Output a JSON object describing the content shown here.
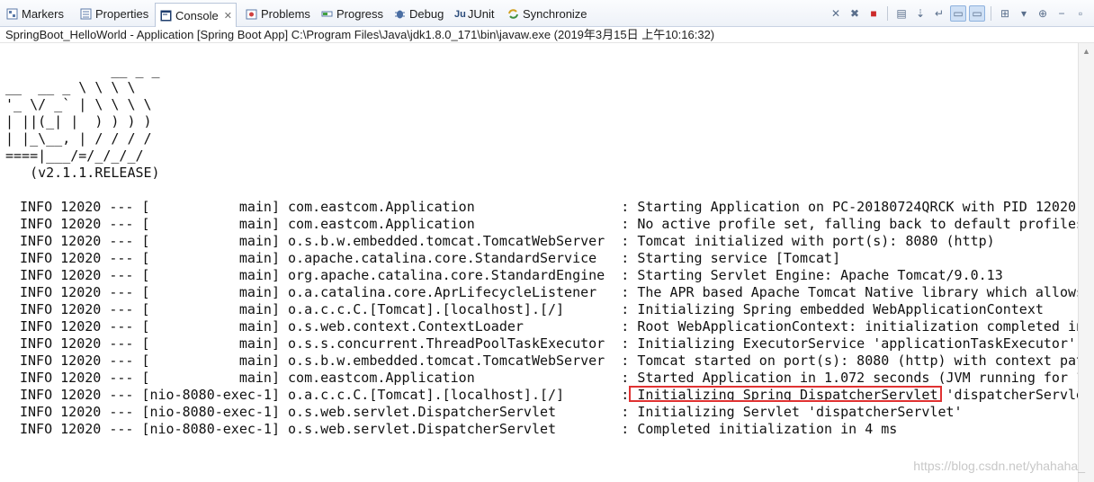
{
  "tabs": [
    {
      "label": "Markers",
      "icon": "markers-icon"
    },
    {
      "label": "Properties",
      "icon": "properties-icon"
    },
    {
      "label": "Console",
      "icon": "console-icon",
      "active": true
    },
    {
      "label": "Problems",
      "icon": "problems-icon"
    },
    {
      "label": "Progress",
      "icon": "progress-icon"
    },
    {
      "label": "Debug",
      "icon": "debug-icon"
    },
    {
      "label": "JUnit",
      "icon": "junit-icon"
    },
    {
      "label": "Synchronize",
      "icon": "synchronize-icon"
    }
  ],
  "console": {
    "description": "SpringBoot_HelloWorld - Application [Spring Boot App] C:\\Program Files\\Java\\jdk1.8.0_171\\bin\\javaw.exe (2019年3月15日 上午10:16:32)",
    "banner": "             __ _ _\n__  __ _ \\ \\ \\ \\\n'_ \\/ _` | \\ \\ \\ \\\n| ||(_| |  ) ) ) )\n| |_\\__, | / / / /\n====|___/=/_/_/_/\n   (v2.1.1.RELEASE)",
    "log_lines": [
      "INFO 12020 --- [           main] com.eastcom.Application                  : Starting Application on PC-20180724QRCK with PID 12020",
      "INFO 12020 --- [           main] com.eastcom.Application                  : No active profile set, falling back to default profiles",
      "INFO 12020 --- [           main] o.s.b.w.embedded.tomcat.TomcatWebServer  : Tomcat initialized with port(s): 8080 (http)",
      "INFO 12020 --- [           main] o.apache.catalina.core.StandardService   : Starting service [Tomcat]",
      "INFO 12020 --- [           main] org.apache.catalina.core.StandardEngine  : Starting Servlet Engine: Apache Tomcat/9.0.13",
      "INFO 12020 --- [           main] o.a.catalina.core.AprLifecycleListener   : The APR based Apache Tomcat Native library which allows",
      "INFO 12020 --- [           main] o.a.c.c.C.[Tomcat].[localhost].[/]       : Initializing Spring embedded WebApplicationContext",
      "INFO 12020 --- [           main] o.s.web.context.ContextLoader            : Root WebApplicationContext: initialization completed in",
      "INFO 12020 --- [           main] o.s.s.concurrent.ThreadPoolTaskExecutor  : Initializing ExecutorService 'applicationTaskExecutor'",
      "INFO 12020 --- [           main] o.s.b.w.embedded.tomcat.TomcatWebServer  : Tomcat started on port(s): 8080 (http) with context pat",
      "INFO 12020 --- [           main] com.eastcom.Application                  : Started Application in 1.072 seconds (JVM running for 1",
      "INFO 12020 --- [nio-8080-exec-1] o.a.c.c.C.[Tomcat].[localhost].[/]       : Initializing Spring DispatcherServlet 'dispatcherServle",
      "INFO 12020 --- [nio-8080-exec-1] o.s.web.servlet.DispatcherServlet        : Initializing Servlet 'dispatcherServlet'",
      "INFO 12020 --- [nio-8080-exec-1] o.s.web.servlet.DispatcherServlet        : Completed initialization in 4 ms"
    ],
    "highlighted_text": "Initializing Spring DispatcherServlet"
  },
  "watermark": "https://blog.csdn.net/yhahaha_",
  "colors": {
    "highlight_border": "#e03232",
    "active_tab_bg": "#ffffff"
  }
}
